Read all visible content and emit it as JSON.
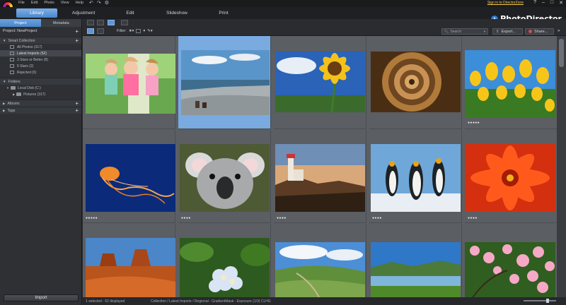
{
  "menubar": {
    "items": [
      "File",
      "Edit",
      "Photo",
      "View",
      "Help"
    ],
    "signin": "Sign in to DirectorZone",
    "window_controls": [
      "?",
      "–",
      "□",
      "✕"
    ]
  },
  "tabs": [
    "Library",
    "Adjustment",
    "Edit",
    "Slideshow",
    "Print"
  ],
  "active_tab": "Library",
  "brand": "PhotoDirector",
  "left_panel": {
    "tabs": [
      "Project",
      "Metadata"
    ],
    "project_label": "Project: NewProject",
    "smart_collection": {
      "label": "Smart Collection",
      "items": [
        "All Photos (317)",
        "Latest Imports (52)",
        "3 Stars or Better (8)",
        "5 Stars (2)",
        "Rejected (0)"
      ]
    },
    "folders": {
      "label": "Folders",
      "items": [
        "Local Disk (C:)",
        "Pictures (317)"
      ]
    },
    "albums": "Albums",
    "tags": "Tags",
    "import_button": "Import"
  },
  "toolbar": {
    "filter_label": "Filter:",
    "search_placeholder": "Search",
    "export_label": "Export...",
    "share_label": "Share..."
  },
  "photos": [
    {
      "subject": "three-children-running",
      "stars": "",
      "selected": false
    },
    {
      "subject": "seaside-cliff-people",
      "stars": "",
      "selected": true
    },
    {
      "subject": "sunflower",
      "stars": "",
      "selected": false
    },
    {
      "subject": "spiral-staircase",
      "stars": "",
      "selected": false
    },
    {
      "subject": "yellow-tulips",
      "stars": "●●●●●",
      "selected": false
    },
    {
      "subject": "jellyfish",
      "stars": "●●●●●",
      "selected": false
    },
    {
      "subject": "koala",
      "stars": "●●●●",
      "selected": false
    },
    {
      "subject": "lighthouse",
      "stars": "●●●●",
      "selected": false
    },
    {
      "subject": "penguins",
      "stars": "●●●●",
      "selected": false
    },
    {
      "subject": "red-chrysanthemum",
      "stars": "●●●●",
      "selected": false
    },
    {
      "subject": "desert-mesa",
      "stars": "",
      "selected": false
    },
    {
      "subject": "hydrangea",
      "stars": "",
      "selected": false
    },
    {
      "subject": "green-hills",
      "stars": "",
      "selected": false
    },
    {
      "subject": "lake-landscape",
      "stars": "",
      "selected": false
    },
    {
      "subject": "cherry-blossoms",
      "stars": "",
      "selected": false
    }
  ],
  "status": {
    "left": "1 selected - 52 displayed",
    "mid": "Collection / Latest Imports / Regional - GradientMask - Exposure (1/3) CLHG"
  },
  "colors": {
    "accent": "#4a86cc",
    "selection": "#79abe0",
    "grid_bg": "#5b5e63",
    "signin": "#f5c94c"
  }
}
